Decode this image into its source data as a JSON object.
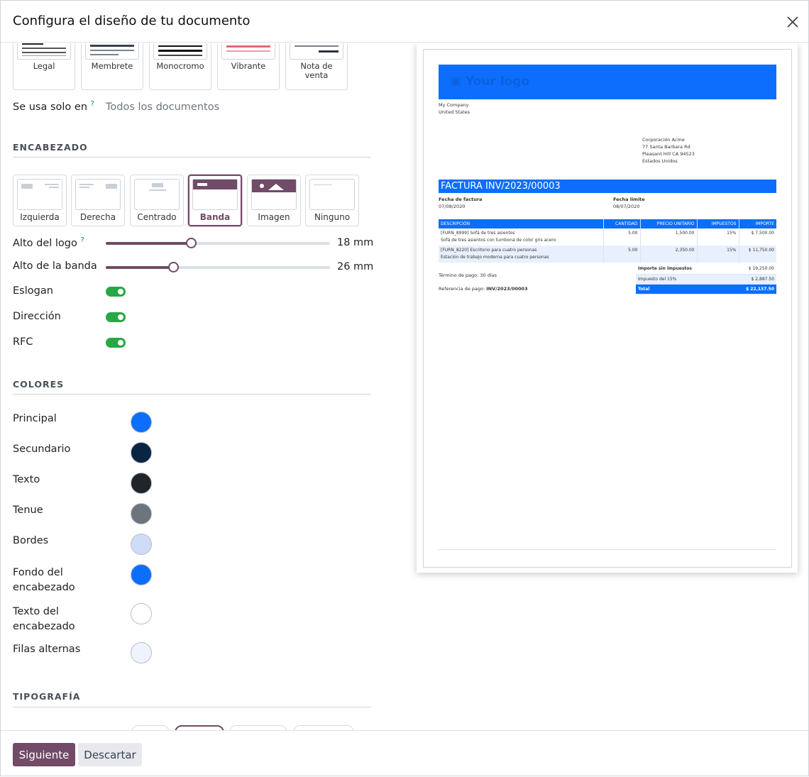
{
  "dialog": {
    "title": "Configura el diseño de tu documento",
    "close_icon": "close-icon"
  },
  "layouts": [
    {
      "label": "Legal",
      "accent": "#222222"
    },
    {
      "label": "Membrete",
      "accent": "#3a4150"
    },
    {
      "label": "Monocromo",
      "accent": "#111111"
    },
    {
      "label": "Vibrante",
      "accent": "#dc3545"
    },
    {
      "label": "Nota de venta",
      "accent": "#2a3142"
    }
  ],
  "usage": {
    "label": "Se usa solo en",
    "help": "?",
    "value": "Todos los documentos"
  },
  "header_section": {
    "title": "ENCABEZADO",
    "options": [
      "Izquierda",
      "Derecha",
      "Centrado",
      "Banda",
      "Imagen",
      "Ninguno"
    ],
    "selected": "Banda",
    "logo_height": {
      "label": "Alto del logo",
      "help": "?",
      "value": "18 mm",
      "fraction": 0.38
    },
    "band_height": {
      "label": "Alto de la banda",
      "value": "26 mm",
      "fraction": 0.3
    },
    "toggles": [
      {
        "label": "Eslogan",
        "on": true
      },
      {
        "label": "Dirección",
        "on": true
      },
      {
        "label": "RFC",
        "on": true
      }
    ]
  },
  "colors_section": {
    "title": "COLORES",
    "colors": [
      {
        "label": "Principal",
        "hex": "#0d6efd"
      },
      {
        "label": "Secundario",
        "hex": "#0a2444"
      },
      {
        "label": "Texto",
        "hex": "#212529"
      },
      {
        "label": "Tenue",
        "hex": "#6c757d"
      },
      {
        "label": "Bordes",
        "hex": "#cfdcf7"
      },
      {
        "label": "Fondo del encabezado",
        "hex": "#0d6efd"
      },
      {
        "label": "Texto del encabezado",
        "hex": "#ffffff"
      },
      {
        "label": "Filas alternas",
        "hex": "#eef3fd"
      }
    ]
  },
  "typography_section": {
    "title": "TIPOGRAFÍA"
  },
  "footer": {
    "next_label": "Siguiente",
    "discard_label": "Descartar"
  },
  "preview": {
    "logo_text": "Your logo",
    "company": [
      "My Company",
      "United States"
    ],
    "customer": [
      "Corporación Acme",
      "77 Santa Barbara Rd",
      "Pleasant Hill CA 94523",
      "Estados Unidos"
    ],
    "invoice_title": "FACTURA INV/2023/00003",
    "invoice_date_label": "Fecha de factura",
    "invoice_date": "07/08/2020",
    "due_date_label": "Fecha límite",
    "due_date": "08/07/2020",
    "columns": [
      "DESCRIPCIÓN",
      "CANTIDAD",
      "PRECIO UNITARIO",
      "IMPUESTOS",
      "IMPORTE"
    ],
    "lines": [
      {
        "desc1": "[FURN_8999] Sofá de tres asientos",
        "desc2": "Sofá de tres asientos con tumbona de color gris acero",
        "qty": "5.00",
        "price": "1,500.00",
        "tax": "15%",
        "amount": "$ 7,500.00"
      },
      {
        "desc1": "[FURN_8220] Escritorio para cuatro personas",
        "desc2": "Estación de trabajo moderna para cuatro personas",
        "qty": "5.00",
        "price": "2,350.00",
        "tax": "15%",
        "amount": "$ 11,750.00"
      }
    ],
    "payment_term": "Término de pago: 30 días",
    "payment_ref_label": "Referencia de pago:",
    "payment_ref": "INV/2023/00003",
    "totals": [
      {
        "label": "Importe sin impuestos",
        "value": "$ 19,250.00"
      },
      {
        "label": "Impuesto del 15%",
        "value": "$ 2,887.50"
      },
      {
        "label": "Total",
        "value": "$ 22,137.50"
      }
    ]
  }
}
